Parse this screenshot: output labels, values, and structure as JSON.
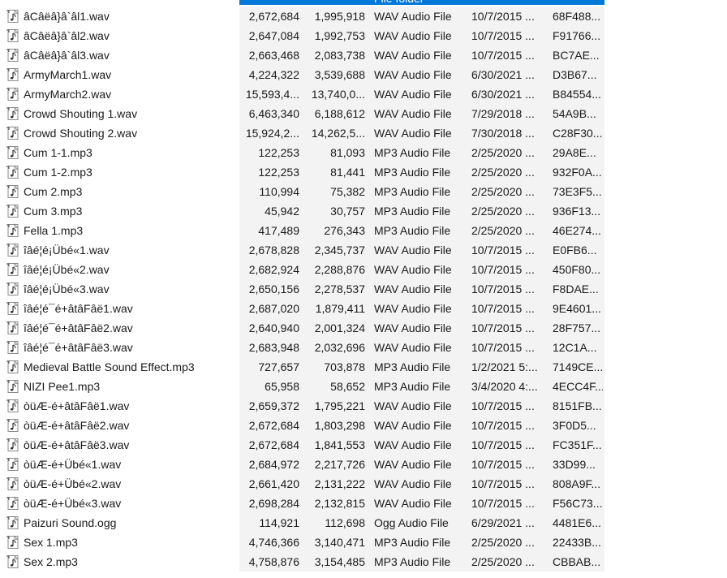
{
  "header": {
    "selected_type": "File folder"
  },
  "files": [
    {
      "icon": "audio-file-icon",
      "name": "âCâëâ}â`âl1.wav",
      "size": "2,672,684",
      "rate": "1,995,918",
      "type": "WAV Audio File",
      "date": "10/7/2015 ...",
      "hash": "68F488..."
    },
    {
      "icon": "audio-file-icon",
      "name": "âCâëâ}â`âl2.wav",
      "size": "2,647,084",
      "rate": "1,992,753",
      "type": "WAV Audio File",
      "date": "10/7/2015 ...",
      "hash": "F91766..."
    },
    {
      "icon": "audio-file-icon",
      "name": "âCâëâ}â`âl3.wav",
      "size": "2,663,468",
      "rate": "2,083,738",
      "type": "WAV Audio File",
      "date": "10/7/2015 ...",
      "hash": "BC7AE..."
    },
    {
      "icon": "audio-file-icon",
      "name": "ArmyMarch1.wav",
      "size": "4,224,322",
      "rate": "3,539,688",
      "type": "WAV Audio File",
      "date": "6/30/2021 ...",
      "hash": "D3B67..."
    },
    {
      "icon": "audio-file-icon",
      "name": "ArmyMarch2.wav",
      "size": "15,593,4...",
      "rate": "13,740,0...",
      "type": "WAV Audio File",
      "date": "6/30/2021 ...",
      "hash": "B84554..."
    },
    {
      "icon": "audio-file-icon",
      "name": "Crowd Shouting 1.wav",
      "size": "6,463,340",
      "rate": "6,188,612",
      "type": "WAV Audio File",
      "date": "7/29/2018 ...",
      "hash": "54A9B..."
    },
    {
      "icon": "audio-file-icon",
      "name": "Crowd Shouting 2.wav",
      "size": "15,924,2...",
      "rate": "14,262,5...",
      "type": "WAV Audio File",
      "date": "7/30/2018 ...",
      "hash": "C28F30..."
    },
    {
      "icon": "audio-file-icon",
      "name": "Cum 1-1.mp3",
      "size": "122,253",
      "rate": "81,093",
      "type": "MP3 Audio File",
      "date": "2/25/2020 ...",
      "hash": "29A8E..."
    },
    {
      "icon": "audio-file-icon",
      "name": "Cum 1-2.mp3",
      "size": "122,253",
      "rate": "81,441",
      "type": "MP3 Audio File",
      "date": "2/25/2020 ...",
      "hash": "932F0A..."
    },
    {
      "icon": "audio-file-icon",
      "name": "Cum 2.mp3",
      "size": "110,994",
      "rate": "75,382",
      "type": "MP3 Audio File",
      "date": "2/25/2020 ...",
      "hash": "73E3F5..."
    },
    {
      "icon": "audio-file-icon",
      "name": "Cum 3.mp3",
      "size": "45,942",
      "rate": "30,757",
      "type": "MP3 Audio File",
      "date": "2/25/2020 ...",
      "hash": "936F13..."
    },
    {
      "icon": "audio-file-icon",
      "name": "Fella 1.mp3",
      "size": "417,489",
      "rate": "276,343",
      "type": "MP3 Audio File",
      "date": "2/25/2020 ...",
      "hash": "46E274..."
    },
    {
      "icon": "audio-file-icon",
      "name": "îâé¦é¡Übé«1.wav",
      "size": "2,678,828",
      "rate": "2,345,737",
      "type": "WAV Audio File",
      "date": "10/7/2015 ...",
      "hash": "E0FB6..."
    },
    {
      "icon": "audio-file-icon",
      "name": "îâé¦é¡Übé«2.wav",
      "size": "2,682,924",
      "rate": "2,288,876",
      "type": "WAV Audio File",
      "date": "10/7/2015 ...",
      "hash": "450F80..."
    },
    {
      "icon": "audio-file-icon",
      "name": "îâé¦é¡Übé«3.wav",
      "size": "2,650,156",
      "rate": "2,278,537",
      "type": "WAV Audio File",
      "date": "10/7/2015 ...",
      "hash": "F8DAE..."
    },
    {
      "icon": "audio-file-icon",
      "name": "îâé¦é¯é+âtâFâë1.wav",
      "size": "2,687,020",
      "rate": "1,879,411",
      "type": "WAV Audio File",
      "date": "10/7/2015 ...",
      "hash": "9E4601..."
    },
    {
      "icon": "audio-file-icon",
      "name": "îâé¦é¯é+âtâFâë2.wav",
      "size": "2,640,940",
      "rate": "2,001,324",
      "type": "WAV Audio File",
      "date": "10/7/2015 ...",
      "hash": "28F757..."
    },
    {
      "icon": "audio-file-icon",
      "name": "îâé¦é¯é+âtâFâë3.wav",
      "size": "2,683,948",
      "rate": "2,032,696",
      "type": "WAV Audio File",
      "date": "10/7/2015 ...",
      "hash": "12C1A..."
    },
    {
      "icon": "audio-file-icon",
      "name": "Medieval Battle Sound Effect.mp3",
      "size": "727,657",
      "rate": "703,878",
      "type": "MP3 Audio File",
      "date": "1/2/2021 5:...",
      "hash": "7149CE..."
    },
    {
      "icon": "audio-file-icon",
      "name": "NIZI Pee1.mp3",
      "size": "65,958",
      "rate": "58,652",
      "type": "MP3 Audio File",
      "date": "3/4/2020 4:...",
      "hash": "4ECC4F..."
    },
    {
      "icon": "audio-file-icon",
      "name": "òüÆ-é+âtâFâë1.wav",
      "size": "2,659,372",
      "rate": "1,795,221",
      "type": "WAV Audio File",
      "date": "10/7/2015 ...",
      "hash": "8151FB..."
    },
    {
      "icon": "audio-file-icon",
      "name": "òüÆ-é+âtâFâë2.wav",
      "size": "2,672,684",
      "rate": "1,803,298",
      "type": "WAV Audio File",
      "date": "10/7/2015 ...",
      "hash": "3F0D5..."
    },
    {
      "icon": "audio-file-icon",
      "name": "òüÆ-é+âtâFâë3.wav",
      "size": "2,672,684",
      "rate": "1,841,553",
      "type": "WAV Audio File",
      "date": "10/7/2015 ...",
      "hash": "FC351F..."
    },
    {
      "icon": "audio-file-icon",
      "name": "òüÆ-é+Übé«1.wav",
      "size": "2,684,972",
      "rate": "2,217,726",
      "type": "WAV Audio File",
      "date": "10/7/2015 ...",
      "hash": "33D99..."
    },
    {
      "icon": "audio-file-icon",
      "name": "òüÆ-é+Übé«2.wav",
      "size": "2,661,420",
      "rate": "2,131,222",
      "type": "WAV Audio File",
      "date": "10/7/2015 ...",
      "hash": "808A9F..."
    },
    {
      "icon": "audio-file-icon",
      "name": "òüÆ-é+Übé«3.wav",
      "size": "2,698,284",
      "rate": "2,132,815",
      "type": "WAV Audio File",
      "date": "10/7/2015 ...",
      "hash": "F56C73..."
    },
    {
      "icon": "audio-file-icon",
      "name": "Paizuri Sound.ogg",
      "size": "114,921",
      "rate": "112,698",
      "type": "Ogg Audio File",
      "date": "6/29/2021 ...",
      "hash": "4481E6..."
    },
    {
      "icon": "audio-file-icon",
      "name": "Sex 1.mp3",
      "size": "4,746,366",
      "rate": "3,140,471",
      "type": "MP3 Audio File",
      "date": "2/25/2020 ...",
      "hash": "22433B..."
    },
    {
      "icon": "audio-file-icon",
      "name": "Sex 2.mp3",
      "size": "4,758,876",
      "rate": "3,154,485",
      "type": "MP3 Audio File",
      "date": "2/25/2020 ...",
      "hash": "CBBAB..."
    }
  ]
}
